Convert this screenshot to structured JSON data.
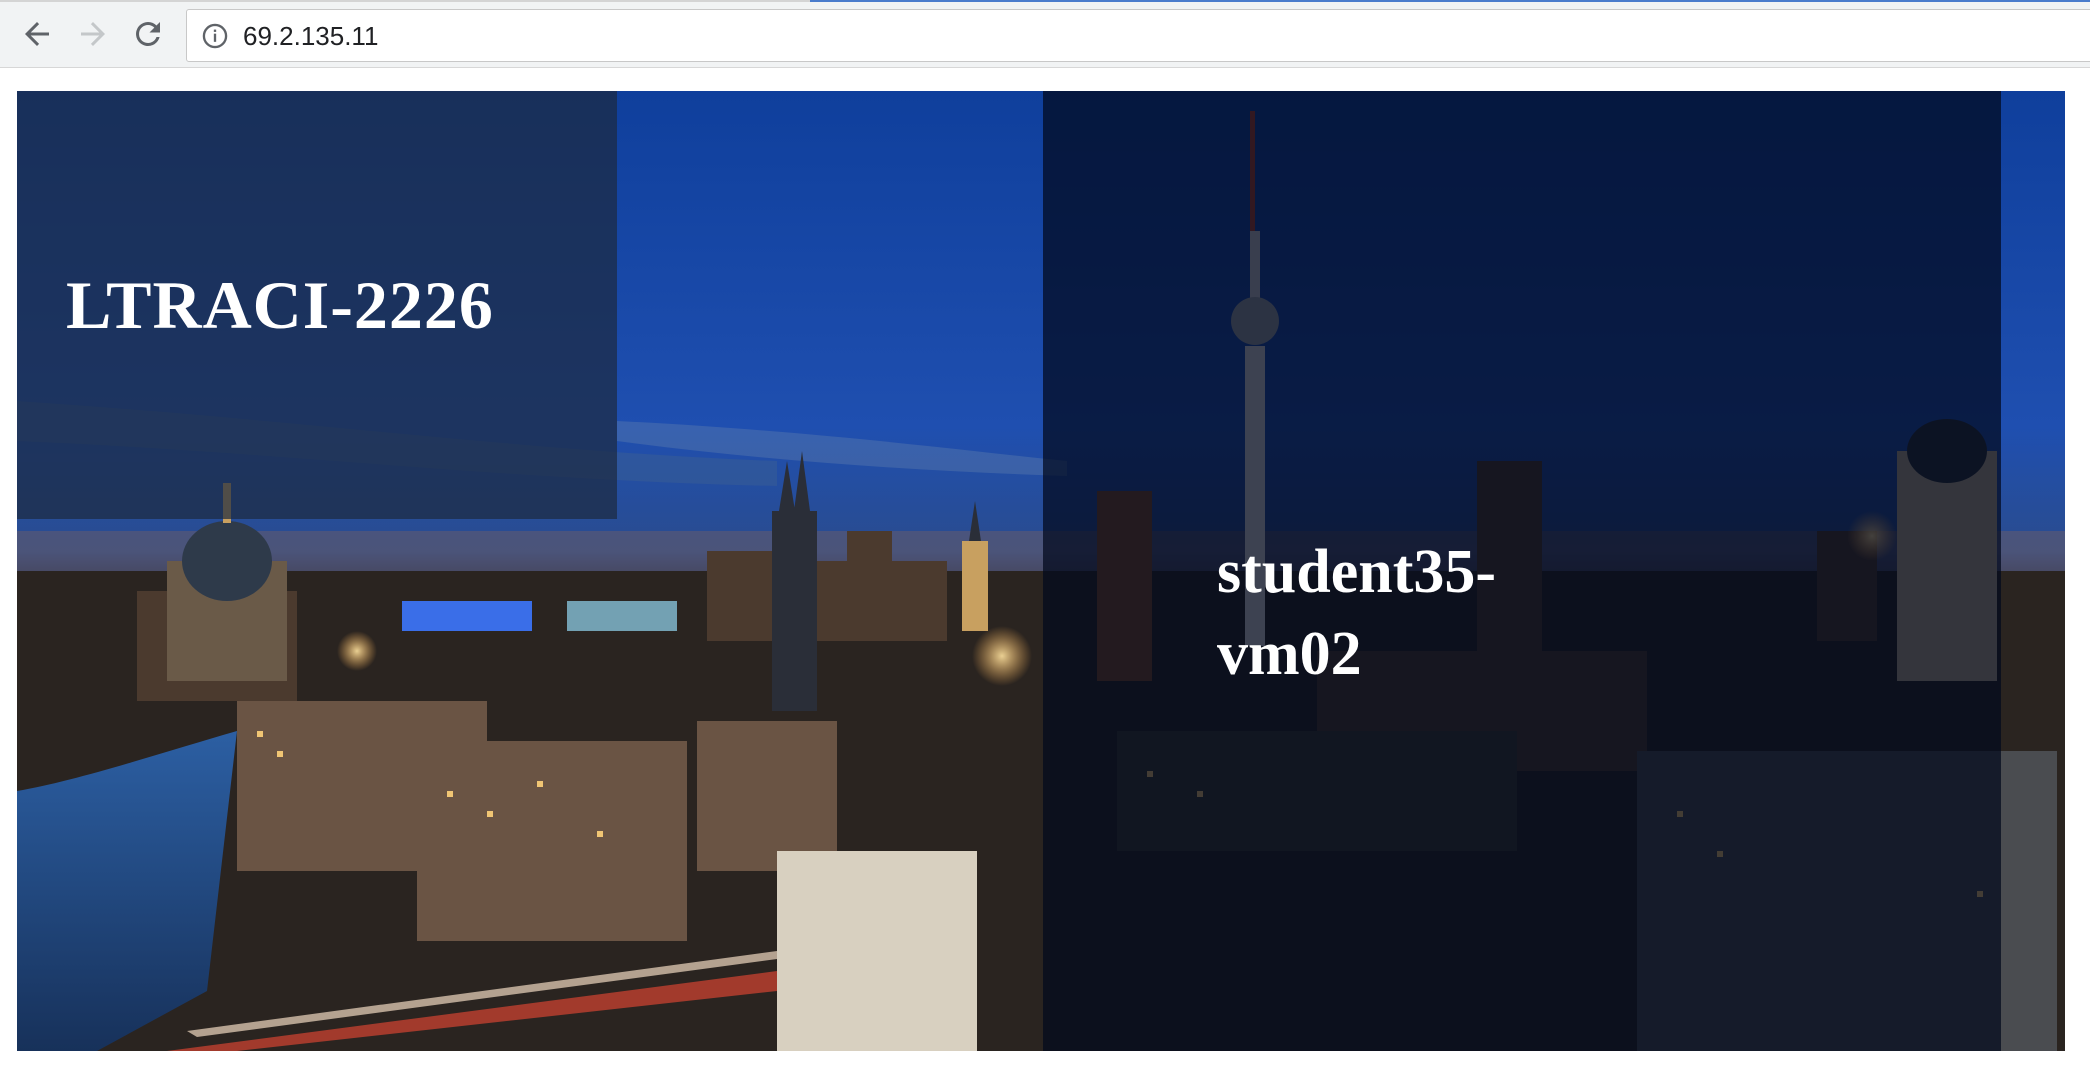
{
  "browser": {
    "url": "69.2.135.11",
    "icons": {
      "back": "back-arrow-icon",
      "forward": "forward-arrow-icon",
      "reload": "reload-icon",
      "info": "info-icon"
    }
  },
  "page": {
    "left_title": "LTRACI-2226",
    "right_title": "student35-vm02",
    "colors": {
      "sky_top": "#0f3f9c",
      "sky_bottom": "#1f4fb0",
      "overlay_left": "#1c2a3e",
      "overlay_right": "#02081c",
      "text": "#ffffff"
    }
  }
}
